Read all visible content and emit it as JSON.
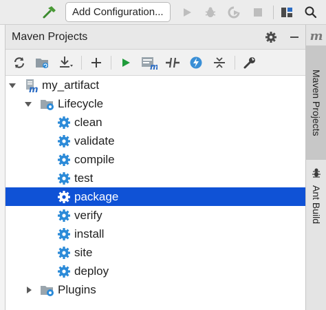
{
  "toolbar": {
    "run_config_label": "Add Configuration...",
    "icons": [
      "build-hammer-icon",
      "run-icon",
      "debug-icon",
      "coverage-icon",
      "stop-icon",
      "project-structure-icon",
      "search-icon"
    ]
  },
  "maven_window": {
    "title": "Maven Projects",
    "toolbar_icons": [
      "reimport-icon",
      "generate-sources-icon",
      "download-icon",
      "add-icon",
      "run-maven-build-icon",
      "execute-maven-goal-icon",
      "toggle-offline-icon",
      "skip-tests-icon",
      "collapse-all-icon",
      "settings-wrench-icon"
    ]
  },
  "tree": {
    "project": "my_artifact",
    "lifecycle_label": "Lifecycle",
    "goals": [
      "clean",
      "validate",
      "compile",
      "test",
      "package",
      "verify",
      "install",
      "site",
      "deploy"
    ],
    "selected_goal": "package",
    "plugins_label": "Plugins"
  },
  "side_tabs": {
    "maven_projects": "Maven Projects",
    "ant_build": "Ant Build",
    "maven_logo_letter": "m"
  },
  "colors": {
    "selection": "#0f52d6",
    "run_green": "#1f9b3a",
    "gear_blue": "#2b8ad8",
    "lightning_blue": "#3a8fd6"
  }
}
